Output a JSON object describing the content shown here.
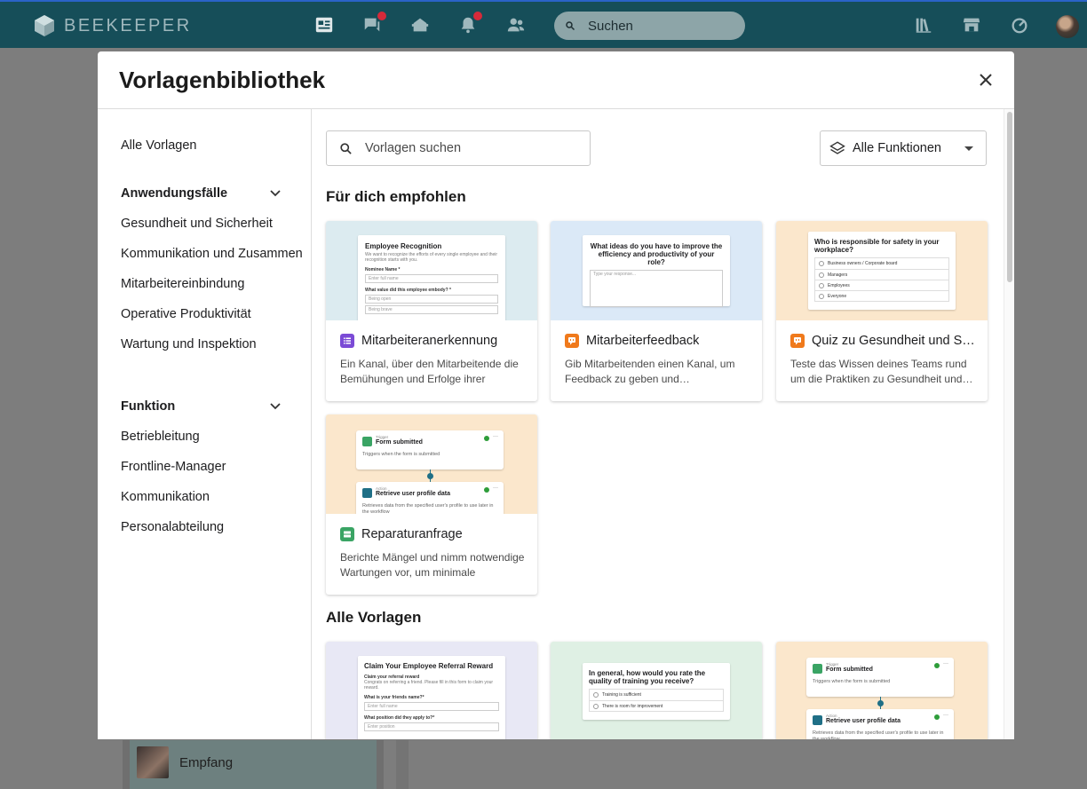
{
  "topbar": {
    "brand": "BEEKEEPER",
    "search_placeholder": "Suchen"
  },
  "background": {
    "chat_item": "Empfang"
  },
  "modal": {
    "title": "Vorlagenbibliothek",
    "close_icon": "close-icon"
  },
  "sidebar": {
    "all_templates": "Alle Vorlagen",
    "use_cases_heading": "Anwendungsfälle",
    "use_cases": [
      "Gesundheit und Sicherheit",
      "Kommunikation und Zusammen",
      "Mitarbeitereinbindung",
      "Operative Produktivität",
      "Wartung und Inspektion"
    ],
    "function_heading": "Funktion",
    "functions": [
      "Betriebleitung",
      "Frontline-Manager",
      "Kommunikation",
      "Personalabteilung"
    ]
  },
  "content": {
    "search_placeholder": "Vorlagen suchen",
    "filter_label": "Alle Funktionen",
    "recommended_heading": "Für dich empfohlen",
    "all_heading": "Alle Vorlagen",
    "recommended": [
      {
        "title": "Mitarbeiteranerkennung",
        "desc": "Ein Kanal, über den Mitarbeitende die Bemühungen und Erfolge ihrer Kollege…",
        "icon": "list-icon",
        "icon_color": "#7b4bd6",
        "bg": "#dcebf0",
        "preview": {
          "title": "Employee Recognition",
          "sub": "We want to recognize the efforts of every single employee and their recognition starts with you.",
          "label1": "Nominee Name *",
          "input1": "Enter full name",
          "label2": "What value did this employee embody? *",
          "opt1": "Being open",
          "opt2": "Being brave"
        }
      },
      {
        "title": "Mitarbeiterfeedback",
        "desc": "Gib Mitarbeitenden einen Kanal, um Feedback zu geben und…",
        "icon": "chat-icon",
        "icon_color": "#f07a1c",
        "bg": "#dbe9f7",
        "preview": {
          "title": "What ideas do you have to improve the efficiency and productivity of your role?",
          "input1": "Type your response..."
        }
      },
      {
        "title": "Quiz zu Gesundheit und Si…",
        "desc": "Teste das Wissen deines Teams rund um die Praktiken zu Gesundheit und…",
        "icon": "chat-icon",
        "icon_color": "#f07a1c",
        "bg": "#fbe7cc",
        "preview": {
          "title": "Who is responsible for safety in your workplace?",
          "options": [
            "Business owners / Corporate board",
            "Managers",
            "Employees",
            "Everyone"
          ]
        }
      },
      {
        "title": "Reparaturanfrage",
        "desc": "Berichte Mängel und nimm notwendige Wartungen vor, um minimale Auszeite…",
        "icon": "workflow-icon",
        "icon_color": "#3aa464",
        "bg": "#fbe7cc",
        "preview": {
          "trigger_small": "Trigger",
          "trigger_title": "Form submitted",
          "trigger_desc": "Triggers when the form is submitted",
          "action_small": "Action",
          "action_title": "Retrieve user profile data",
          "action_desc": "Retrieves data from the specified user's profile to use later in the workflow"
        }
      }
    ],
    "all": [
      {
        "bg": "#e8e8f5",
        "preview": {
          "title": "Claim Your Employee Referral Reward",
          "sub_label": "Claim your referral reward",
          "sub": "Congrats on referring a friend. Please fill in this form to claim your reward.",
          "label1": "What is your friends name?*",
          "input1": "Enter full name",
          "label2": "What position did they apply to?*",
          "input2": "Enter position"
        }
      },
      {
        "bg": "#dff0e4",
        "preview": {
          "title": "In general, how would you rate the quality of training you receive?",
          "options": [
            "Training is sufficient",
            "There is room for improvement"
          ]
        }
      },
      {
        "bg": "#fbe7cc",
        "preview": {
          "trigger_small": "Trigger",
          "trigger_title": "Form submitted",
          "trigger_desc": "Triggers when the form is submitted",
          "action_small": "Action",
          "action_title": "Retrieve user profile data",
          "action_desc": "Retrieves data from the specified user's profile to use later in the workflow"
        }
      }
    ]
  }
}
